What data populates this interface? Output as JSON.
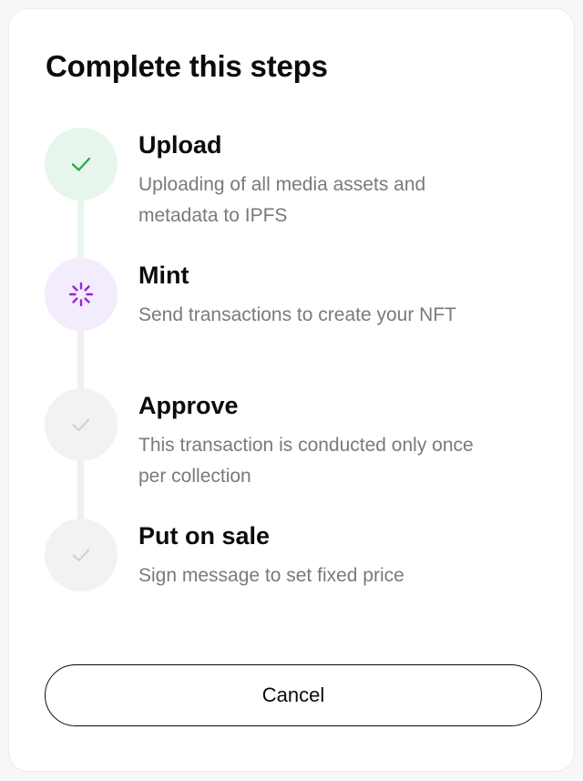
{
  "title": "Complete this steps",
  "colors": {
    "done_bg": "#e6f6ea",
    "done_icon": "#2eaa4f",
    "active_bg": "#f3ecfd",
    "active_icon": "#a020d8",
    "pending_bg": "#f2f2f2",
    "pending_icon": "#cfcfcf"
  },
  "steps": [
    {
      "title": "Upload",
      "description": "Uploading of all media assets and metadata to IPFS",
      "status": "done",
      "icon": "check-icon"
    },
    {
      "title": "Mint",
      "description": "Send transactions to create your NFT",
      "status": "in-progress",
      "icon": "spinner-icon"
    },
    {
      "title": "Approve",
      "description": "This transaction is conducted only once per collection",
      "status": "pending",
      "icon": "check-icon"
    },
    {
      "title": "Put on sale",
      "description": "Sign message to set fixed price",
      "status": "pending",
      "icon": "check-icon"
    }
  ],
  "cancel_label": "Cancel"
}
